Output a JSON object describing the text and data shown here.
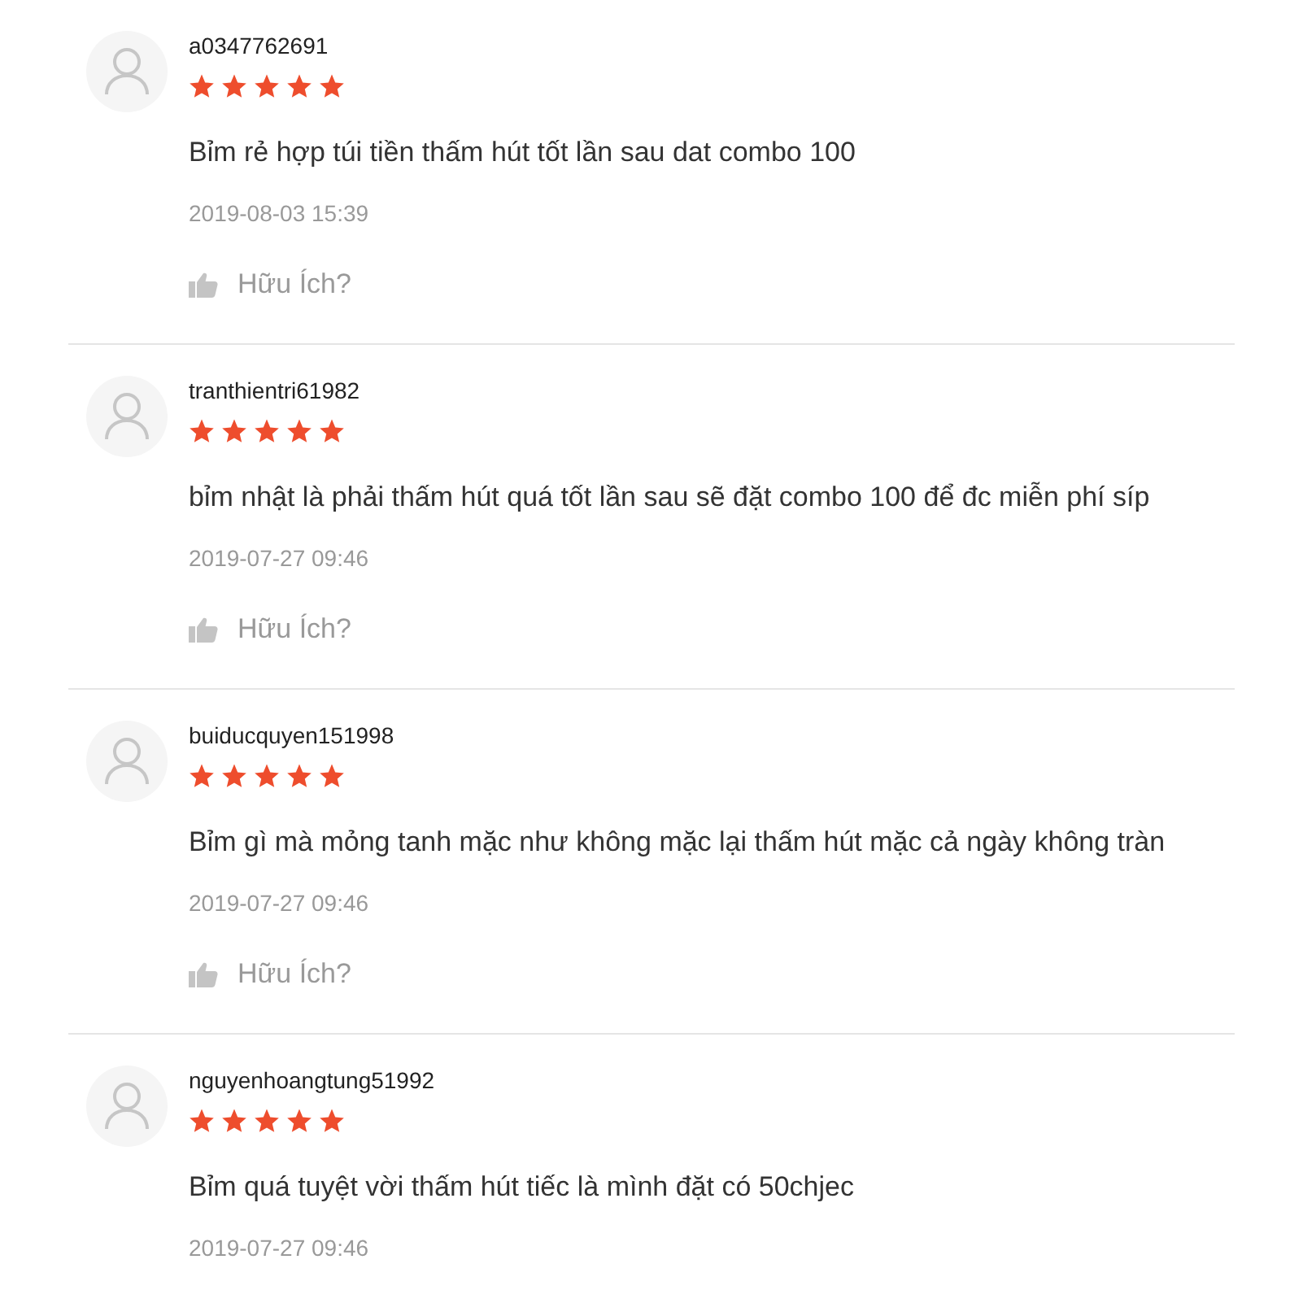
{
  "reviews": [
    {
      "username": "a0347762691",
      "stars": 5,
      "comment": "Bỉm rẻ hợp túi tiền thấm hút tốt lần sau dat combo 100",
      "date": "2019-08-03 15:39",
      "helpful": "Hữu Ích?"
    },
    {
      "username": "tranthientri61982",
      "stars": 5,
      "comment": "bỉm nhật là phải thấm hút quá tốt lần sau sẽ đặt combo 100 để đc miễn phí síp",
      "date": "2019-07-27 09:46",
      "helpful": "Hữu Ích?"
    },
    {
      "username": "buiducquyen151998",
      "stars": 5,
      "comment": "Bỉm gì mà mỏng tanh mặc như không mặc lại thấm hút mặc cả ngày không tràn",
      "date": "2019-07-27 09:46",
      "helpful": "Hữu Ích?"
    },
    {
      "username": "nguyenhoangtung51992",
      "stars": 5,
      "comment": "Bỉm quá tuyệt vời thấm hút tiếc là mình đặt có 50chjec",
      "date": "2019-07-27 09:46"
    }
  ]
}
